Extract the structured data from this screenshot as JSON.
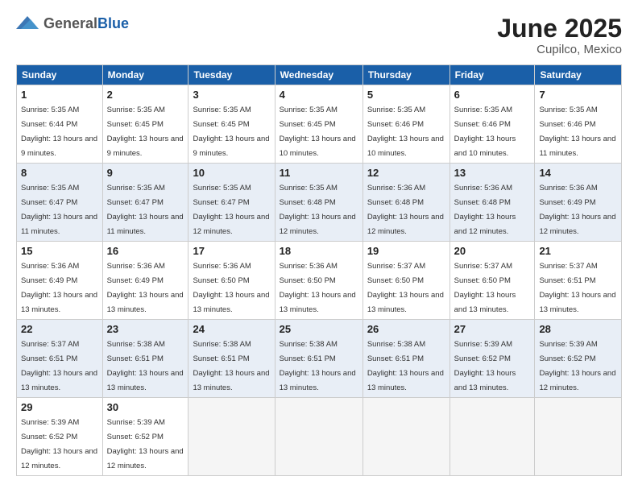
{
  "logo": {
    "general": "General",
    "blue": "Blue"
  },
  "title": "June 2025",
  "location": "Cupilco, Mexico",
  "days_header": [
    "Sunday",
    "Monday",
    "Tuesday",
    "Wednesday",
    "Thursday",
    "Friday",
    "Saturday"
  ],
  "weeks": [
    [
      {
        "day": "1",
        "sunrise": "Sunrise: 5:35 AM",
        "sunset": "Sunset: 6:44 PM",
        "daylight": "Daylight: 13 hours and 9 minutes."
      },
      {
        "day": "2",
        "sunrise": "Sunrise: 5:35 AM",
        "sunset": "Sunset: 6:45 PM",
        "daylight": "Daylight: 13 hours and 9 minutes."
      },
      {
        "day": "3",
        "sunrise": "Sunrise: 5:35 AM",
        "sunset": "Sunset: 6:45 PM",
        "daylight": "Daylight: 13 hours and 9 minutes."
      },
      {
        "day": "4",
        "sunrise": "Sunrise: 5:35 AM",
        "sunset": "Sunset: 6:45 PM",
        "daylight": "Daylight: 13 hours and 10 minutes."
      },
      {
        "day": "5",
        "sunrise": "Sunrise: 5:35 AM",
        "sunset": "Sunset: 6:46 PM",
        "daylight": "Daylight: 13 hours and 10 minutes."
      },
      {
        "day": "6",
        "sunrise": "Sunrise: 5:35 AM",
        "sunset": "Sunset: 6:46 PM",
        "daylight": "Daylight: 13 hours and 10 minutes."
      },
      {
        "day": "7",
        "sunrise": "Sunrise: 5:35 AM",
        "sunset": "Sunset: 6:46 PM",
        "daylight": "Daylight: 13 hours and 11 minutes."
      }
    ],
    [
      {
        "day": "8",
        "sunrise": "Sunrise: 5:35 AM",
        "sunset": "Sunset: 6:47 PM",
        "daylight": "Daylight: 13 hours and 11 minutes."
      },
      {
        "day": "9",
        "sunrise": "Sunrise: 5:35 AM",
        "sunset": "Sunset: 6:47 PM",
        "daylight": "Daylight: 13 hours and 11 minutes."
      },
      {
        "day": "10",
        "sunrise": "Sunrise: 5:35 AM",
        "sunset": "Sunset: 6:47 PM",
        "daylight": "Daylight: 13 hours and 12 minutes."
      },
      {
        "day": "11",
        "sunrise": "Sunrise: 5:35 AM",
        "sunset": "Sunset: 6:48 PM",
        "daylight": "Daylight: 13 hours and 12 minutes."
      },
      {
        "day": "12",
        "sunrise": "Sunrise: 5:36 AM",
        "sunset": "Sunset: 6:48 PM",
        "daylight": "Daylight: 13 hours and 12 minutes."
      },
      {
        "day": "13",
        "sunrise": "Sunrise: 5:36 AM",
        "sunset": "Sunset: 6:48 PM",
        "daylight": "Daylight: 13 hours and 12 minutes."
      },
      {
        "day": "14",
        "sunrise": "Sunrise: 5:36 AM",
        "sunset": "Sunset: 6:49 PM",
        "daylight": "Daylight: 13 hours and 12 minutes."
      }
    ],
    [
      {
        "day": "15",
        "sunrise": "Sunrise: 5:36 AM",
        "sunset": "Sunset: 6:49 PM",
        "daylight": "Daylight: 13 hours and 13 minutes."
      },
      {
        "day": "16",
        "sunrise": "Sunrise: 5:36 AM",
        "sunset": "Sunset: 6:49 PM",
        "daylight": "Daylight: 13 hours and 13 minutes."
      },
      {
        "day": "17",
        "sunrise": "Sunrise: 5:36 AM",
        "sunset": "Sunset: 6:50 PM",
        "daylight": "Daylight: 13 hours and 13 minutes."
      },
      {
        "day": "18",
        "sunrise": "Sunrise: 5:36 AM",
        "sunset": "Sunset: 6:50 PM",
        "daylight": "Daylight: 13 hours and 13 minutes."
      },
      {
        "day": "19",
        "sunrise": "Sunrise: 5:37 AM",
        "sunset": "Sunset: 6:50 PM",
        "daylight": "Daylight: 13 hours and 13 minutes."
      },
      {
        "day": "20",
        "sunrise": "Sunrise: 5:37 AM",
        "sunset": "Sunset: 6:50 PM",
        "daylight": "Daylight: 13 hours and 13 minutes."
      },
      {
        "day": "21",
        "sunrise": "Sunrise: 5:37 AM",
        "sunset": "Sunset: 6:51 PM",
        "daylight": "Daylight: 13 hours and 13 minutes."
      }
    ],
    [
      {
        "day": "22",
        "sunrise": "Sunrise: 5:37 AM",
        "sunset": "Sunset: 6:51 PM",
        "daylight": "Daylight: 13 hours and 13 minutes."
      },
      {
        "day": "23",
        "sunrise": "Sunrise: 5:38 AM",
        "sunset": "Sunset: 6:51 PM",
        "daylight": "Daylight: 13 hours and 13 minutes."
      },
      {
        "day": "24",
        "sunrise": "Sunrise: 5:38 AM",
        "sunset": "Sunset: 6:51 PM",
        "daylight": "Daylight: 13 hours and 13 minutes."
      },
      {
        "day": "25",
        "sunrise": "Sunrise: 5:38 AM",
        "sunset": "Sunset: 6:51 PM",
        "daylight": "Daylight: 13 hours and 13 minutes."
      },
      {
        "day": "26",
        "sunrise": "Sunrise: 5:38 AM",
        "sunset": "Sunset: 6:51 PM",
        "daylight": "Daylight: 13 hours and 13 minutes."
      },
      {
        "day": "27",
        "sunrise": "Sunrise: 5:39 AM",
        "sunset": "Sunset: 6:52 PM",
        "daylight": "Daylight: 13 hours and 13 minutes."
      },
      {
        "day": "28",
        "sunrise": "Sunrise: 5:39 AM",
        "sunset": "Sunset: 6:52 PM",
        "daylight": "Daylight: 13 hours and 12 minutes."
      }
    ],
    [
      {
        "day": "29",
        "sunrise": "Sunrise: 5:39 AM",
        "sunset": "Sunset: 6:52 PM",
        "daylight": "Daylight: 13 hours and 12 minutes."
      },
      {
        "day": "30",
        "sunrise": "Sunrise: 5:39 AM",
        "sunset": "Sunset: 6:52 PM",
        "daylight": "Daylight: 13 hours and 12 minutes."
      },
      null,
      null,
      null,
      null,
      null
    ]
  ]
}
